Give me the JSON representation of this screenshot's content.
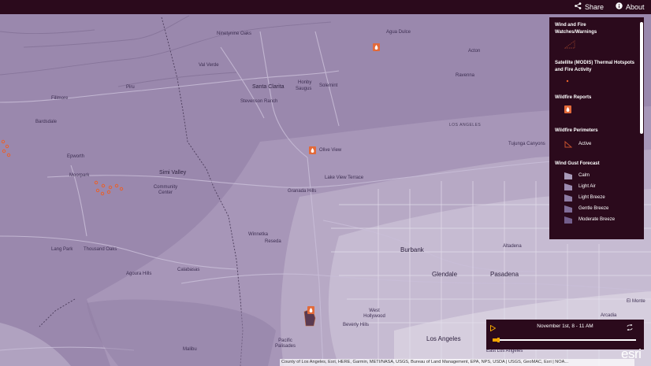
{
  "topbar": {
    "share_label": "Share",
    "share_icon": "share-icon",
    "about_label": "About",
    "about_icon": "info-icon"
  },
  "legend": {
    "sections": {
      "watches": {
        "title": "Wind and Fire Watches/Warnings"
      },
      "satellite": {
        "title": "Satellite (MODIS) Thermal Hotspots and Fire Activity"
      },
      "reports": {
        "title": "Wildfire Reports"
      },
      "perimeters": {
        "title": "Wildfire Perimeters",
        "items": [
          {
            "label": "Active"
          }
        ]
      },
      "wind": {
        "title": "Wind Gust Forecast",
        "items": [
          {
            "label": "Calm",
            "color": "#a99bb9"
          },
          {
            "label": "Light Air",
            "color": "#9c8bb0"
          },
          {
            "label": "Light Breeze",
            "color": "#8e7ca4"
          },
          {
            "label": "Gentle Breeze",
            "color": "#806d98"
          },
          {
            "label": "Moderate Breeze",
            "color": "#725e8b"
          }
        ]
      }
    }
  },
  "timeslider": {
    "label": "November 1st, 8 - 11 AM",
    "play_icon": "play-icon",
    "loop_icon": "loop-icon",
    "progress": 0.04
  },
  "map": {
    "labels": {
      "ninetynine_oaks": "Ninetynine Oaks",
      "agua_dulce": "Agua Dulce",
      "acton": "Acton",
      "val_verde": "Val Verde",
      "piru": "Piru",
      "fillmore": "Fillmore",
      "santa_clarita": "Santa Clarita",
      "honby": "Honby",
      "saugus": "Saugus",
      "solemint": "Solemint",
      "ravenna": "Ravenna",
      "stevenson_ranch": "Stevenson Ranch",
      "bardsdale": "Bardsdale",
      "los_angeles_county": "LOS ANGELES",
      "olive_view": "Olive View",
      "tujunga": "Tujunga Canyons",
      "epworth": "Epworth",
      "moorpark": "Moorpark",
      "simi_valley": "Simi Valley",
      "community_center": "Community Center",
      "granada_hills": "Granada Hills",
      "lake_view_terrace": "Lake View Terrace",
      "thousand_oaks": "Thousand Oaks",
      "lang_park": "Lang Park",
      "burbank": "Burbank",
      "winnetka": "Winnetka",
      "reseda": "Reseda",
      "agoura_hills": "Agoura Hills",
      "calabasas": "Calabasas",
      "altadena": "Altadena",
      "glendale": "Glendale",
      "pasadena": "Pasadena",
      "west_hollywood": "West Hollywood",
      "beverly_hills": "Beverly Hills",
      "los_angeles": "Los Angeles",
      "pacific_palisades": "Pacific Palisades",
      "malibu": "Malibu",
      "east_los_angeles": "East Los Angeles",
      "arcadia": "Arcadia",
      "el_monte": "El Monte"
    }
  },
  "attribution": "County of Los Angeles, Esri, HERE, Garmin, METI/NASA, USGS, Bureau of Land Management, EPA, NPS, USDA | USGS, GeoMAC, Esri | NOA...",
  "esri_logo": "esri"
}
